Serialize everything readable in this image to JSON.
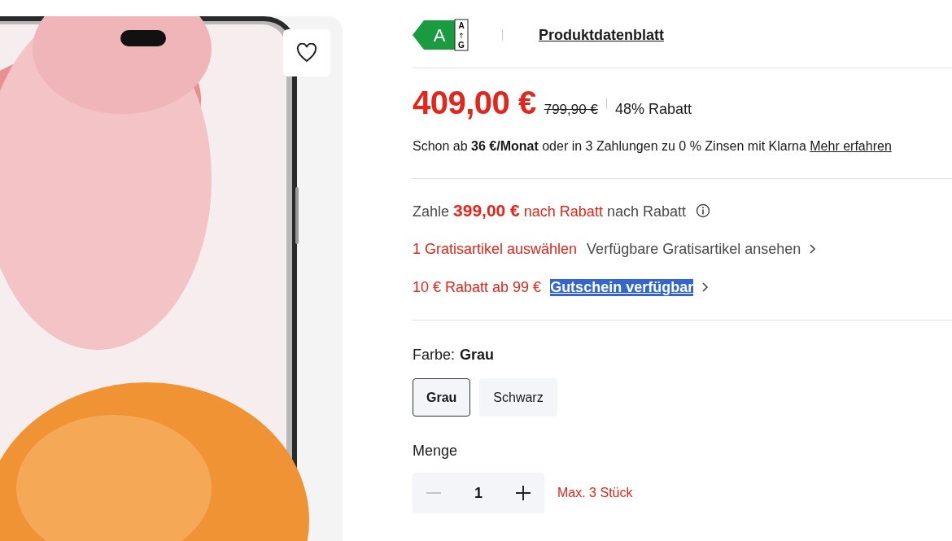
{
  "energy_label": {
    "class": "A",
    "scale_top": "A",
    "scale_arrow": "↑",
    "scale_bottom": "G"
  },
  "datasheet_link": "Produktdatenblatt",
  "price": {
    "current": "409,00 €",
    "original": "799,90 €",
    "discount": "48% Rabatt"
  },
  "financing": {
    "text": "Schon ab **36 €/Monat** oder in 3 Zahlungen zu 0 % Zinsen mit Klarna",
    "link": "Mehr erfahren"
  },
  "discount_price": {
    "lead": "Zahle",
    "amount": "399,00 €",
    "amount_note": "nach Rabatt",
    "trail": "nach Rabatt"
  },
  "free_item": {
    "label": "1 Gratisartikel auswählen",
    "link": "Verfügbare Gratisartikel ansehen"
  },
  "voucher": {
    "label": "10 € Rabatt ab 99 €",
    "link": "Gutschein verfügbar",
    "highlighted": true
  },
  "color": {
    "label": "Farbe:",
    "value": "Grau",
    "options": [
      {
        "label": "Grau",
        "selected": true
      },
      {
        "label": "Schwarz",
        "selected": false
      }
    ]
  },
  "quantity": {
    "label": "Menge",
    "value": "1",
    "minus_disabled": true,
    "max_note": "Max. 3 Stück"
  }
}
